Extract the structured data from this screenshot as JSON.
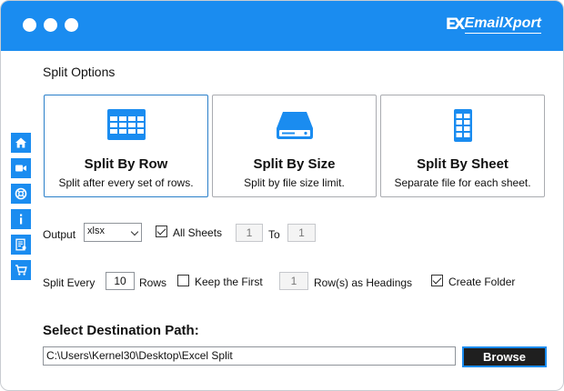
{
  "brand": {
    "mark": "EX",
    "name": "EmailXport"
  },
  "sidebar": {
    "icons": [
      "home-icon",
      "video-icon",
      "support-icon",
      "info-icon",
      "document-icon",
      "cart-icon"
    ]
  },
  "split_options": {
    "title": "Split Options",
    "cards": [
      {
        "title": "Split By Row",
        "desc": "Split after every set of rows.",
        "icon": "table-icon",
        "selected": true
      },
      {
        "title": "Split By Size",
        "desc": "Split by file size limit.",
        "icon": "drive-icon",
        "selected": false
      },
      {
        "title": "Split By Sheet",
        "desc": "Separate file for each sheet.",
        "icon": "sheet-icon",
        "selected": false
      }
    ]
  },
  "output": {
    "label": "Output",
    "format": "xlsx",
    "all_sheets_label": "All Sheets",
    "all_sheets_checked": true,
    "from_value": "1",
    "to_label": "To",
    "to_value": "1"
  },
  "split_every": {
    "label": "Split Every",
    "rows_value": "10",
    "rows_label": "Rows",
    "keep_first_label": "Keep the First",
    "keep_first_checked": false,
    "keep_first_value": "1",
    "headings_label": "Row(s) as Headings",
    "create_folder_label": "Create Folder",
    "create_folder_checked": true
  },
  "destination": {
    "title": "Select Destination Path:",
    "path": "C:\\Users\\Kernel30\\Desktop\\Excel Split",
    "browse_label": "Browse"
  },
  "colors": {
    "accent": "#1a8cf0",
    "button_dark": "#1f1f1f"
  }
}
